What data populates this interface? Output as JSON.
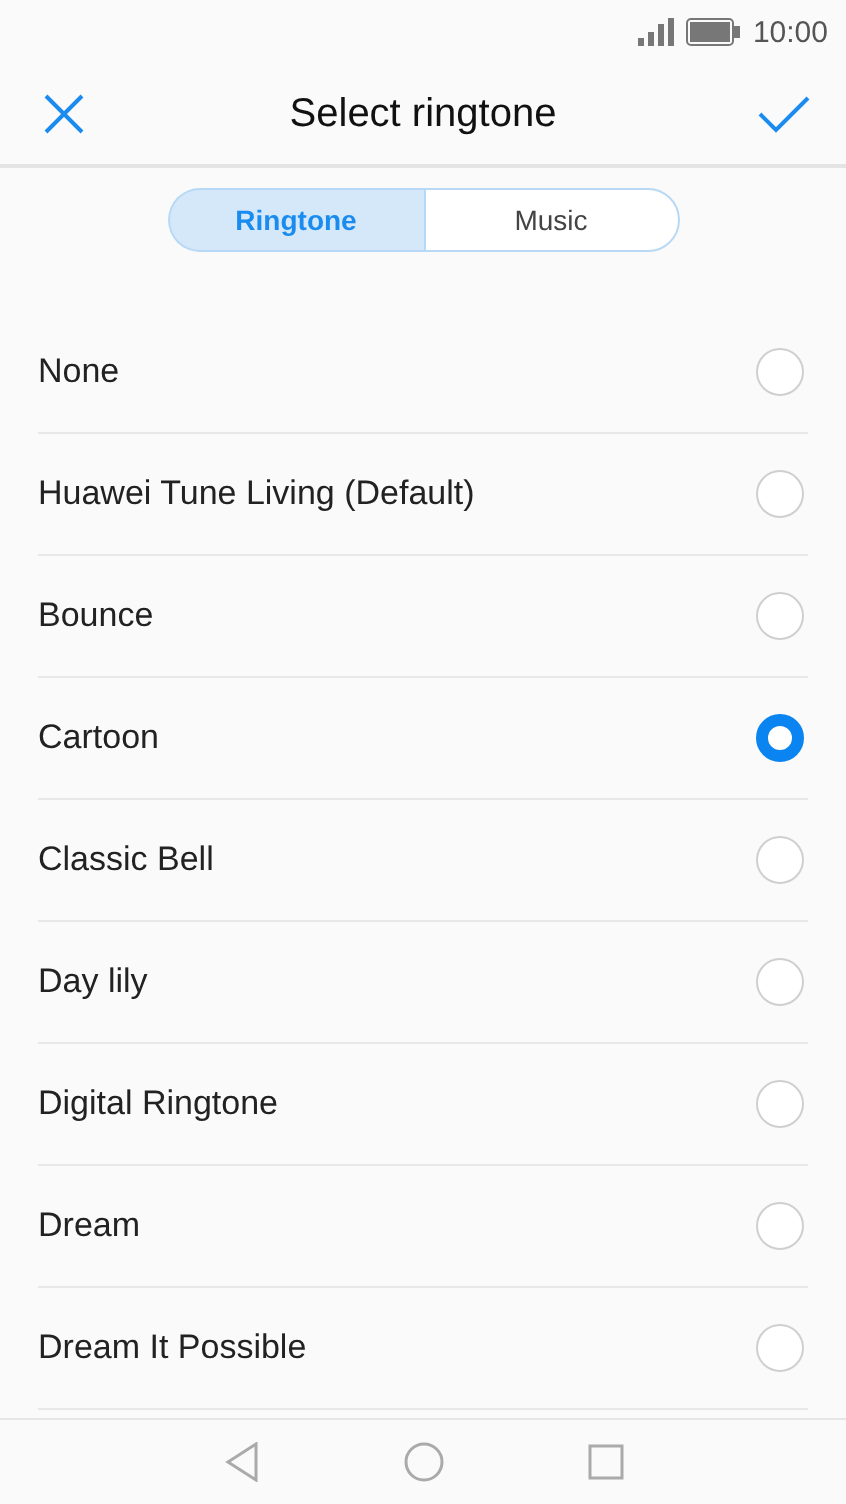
{
  "status_bar": {
    "time": "10:00"
  },
  "header": {
    "title": "Select ringtone"
  },
  "tabs": [
    {
      "label": "Ringtone",
      "selected": true
    },
    {
      "label": "Music",
      "selected": false
    }
  ],
  "ringtones": [
    {
      "name": "None",
      "selected": false
    },
    {
      "name": "Huawei Tune Living (Default)",
      "selected": false
    },
    {
      "name": "Bounce",
      "selected": false
    },
    {
      "name": "Cartoon",
      "selected": true
    },
    {
      "name": "Classic Bell",
      "selected": false
    },
    {
      "name": "Day lily",
      "selected": false
    },
    {
      "name": "Digital Ringtone",
      "selected": false
    },
    {
      "name": "Dream",
      "selected": false
    },
    {
      "name": "Dream It Possible",
      "selected": false
    }
  ]
}
